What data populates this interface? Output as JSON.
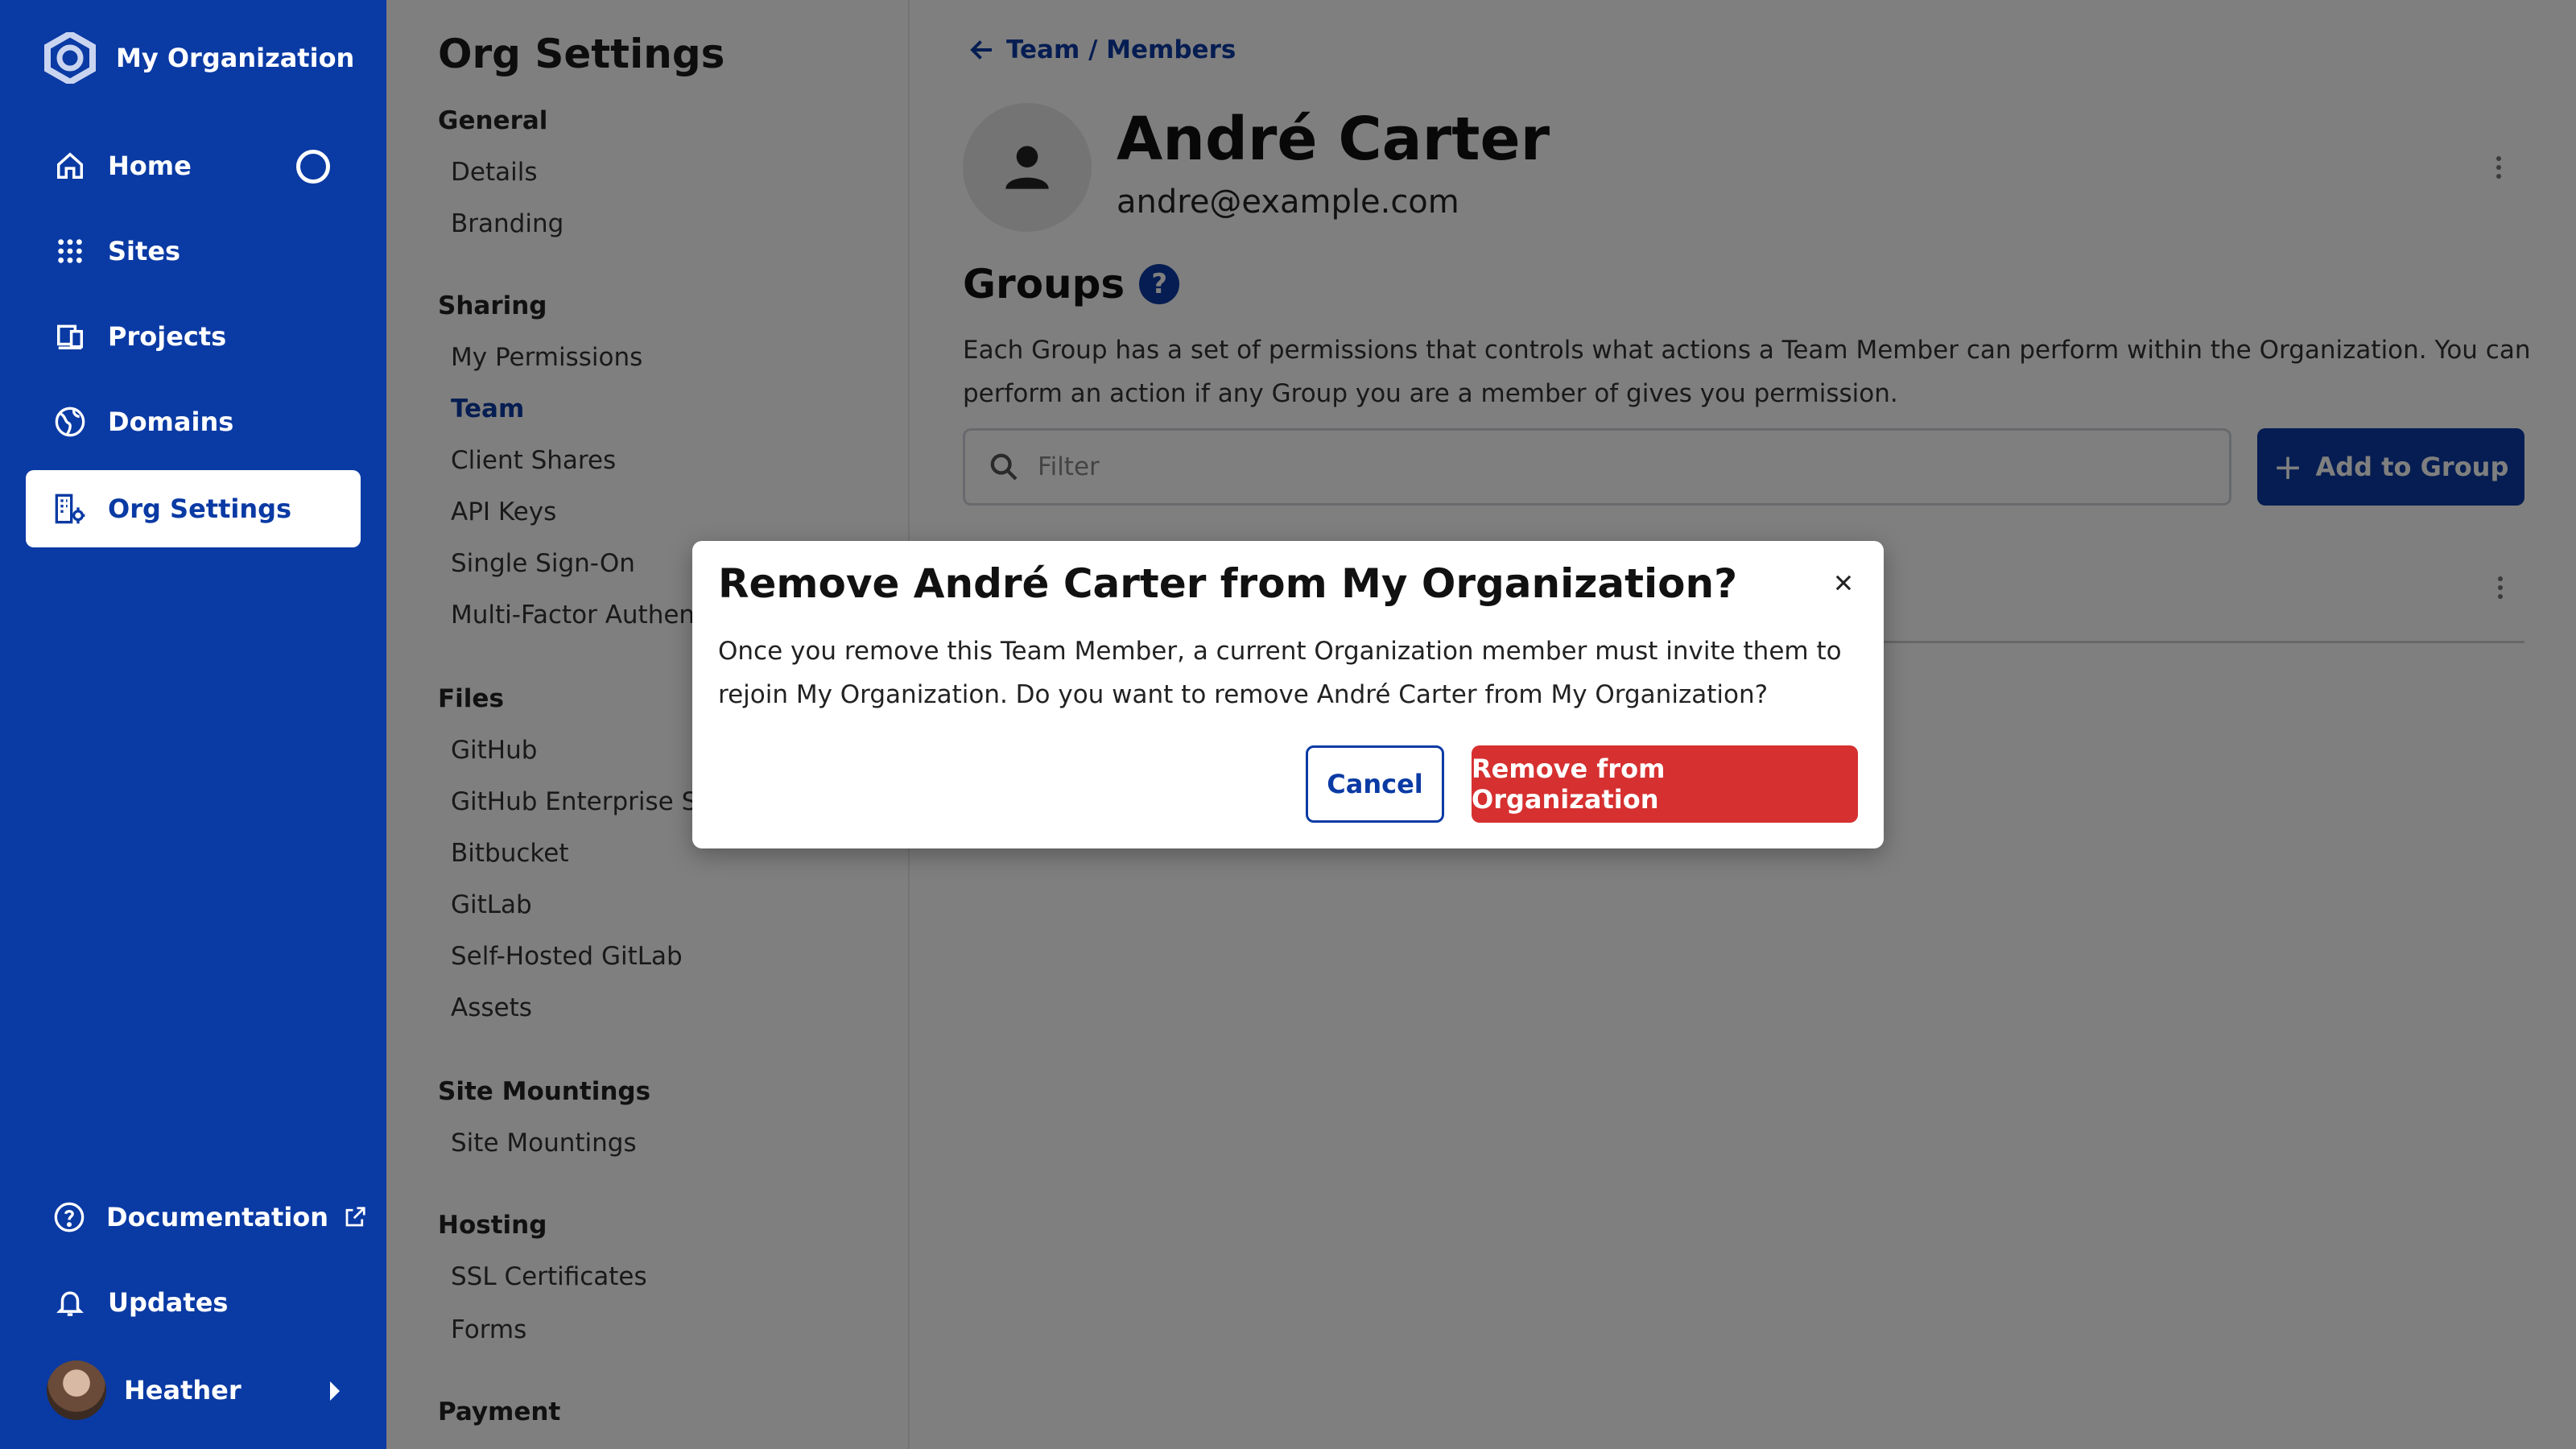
{
  "brand": {
    "name": "My Organization",
    "logo_icon": "org-logo-icon"
  },
  "nav": {
    "items": [
      {
        "label": "Home",
        "icon": "home-icon"
      },
      {
        "label": "Sites",
        "icon": "grid-icon"
      },
      {
        "label": "Projects",
        "icon": "projects-icon"
      },
      {
        "label": "Domains",
        "icon": "globe-icon"
      },
      {
        "label": "Org Settings",
        "icon": "org-settings-icon"
      }
    ],
    "active": "Org Settings",
    "documentation": "Documentation",
    "updates": "Updates",
    "user": "Heather"
  },
  "settings": {
    "title": "Org Settings",
    "sections": {
      "general": {
        "title": "General",
        "links": [
          "Details",
          "Branding"
        ]
      },
      "sharing": {
        "title": "Sharing",
        "links": [
          "My Permissions",
          "Team",
          "Client Shares",
          "API Keys",
          "Single Sign-On",
          "Multi-Factor Authent"
        ]
      },
      "files": {
        "title": "Files",
        "links": [
          "GitHub",
          "GitHub Enterprise Se",
          "Bitbucket",
          "GitLab",
          "Self-Hosted GitLab",
          "Assets"
        ]
      },
      "mountings": {
        "title": "Site Mountings",
        "links": [
          "Site Mountings"
        ]
      },
      "hosting": {
        "title": "Hosting",
        "links": [
          "SSL Certificates",
          "Forms"
        ]
      },
      "payment": {
        "title": "Payment"
      }
    },
    "current": "Team"
  },
  "main": {
    "breadcrumb": "Team / Members",
    "member": {
      "name": "André Carter",
      "email": "andre@example.com"
    },
    "groups": {
      "title": "Groups",
      "help": "?",
      "description": "Each Group has a set of permissions that controls what actions a Team Member can perform within the Organization. You can perform an action if any Group you are a member of gives you permission.",
      "filter_placeholder": "Filter",
      "add_label": "Add to Group"
    }
  },
  "modal": {
    "title": "Remove André Carter from My Organization?",
    "body": "Once you remove this Team Member, a current Organization member must invite them to rejoin My Organization. Do you want to remove André Carter from My Organization?",
    "cancel": "Cancel",
    "confirm": "Remove from Organization"
  },
  "colors": {
    "nav_bg": "#0a3aa4",
    "accent": "#0a3aa4",
    "danger": "#d63030"
  }
}
